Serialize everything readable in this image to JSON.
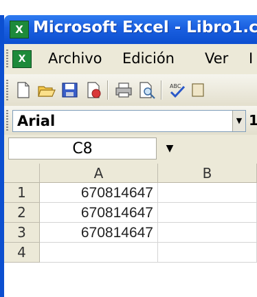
{
  "window": {
    "title": "Microsoft Excel - Libro1.c",
    "app_icon": "excel-icon"
  },
  "menubar": {
    "items": [
      "Archivo",
      "Edición",
      "Ver",
      "I"
    ]
  },
  "toolbar": {
    "buttons": [
      "new-icon",
      "open-icon",
      "save-icon",
      "permission-icon",
      "print-icon",
      "print-preview-icon",
      "spelling-icon"
    ]
  },
  "formatting": {
    "font": "Arial",
    "size": "1"
  },
  "formula_bar": {
    "cell_ref": "C8"
  },
  "sheet": {
    "columns": [
      "A",
      "B"
    ],
    "rows": [
      {
        "num": "1",
        "a": "670814647",
        "b": ""
      },
      {
        "num": "2",
        "a": "670814647",
        "b": ""
      },
      {
        "num": "3",
        "a": "670814647",
        "b": ""
      },
      {
        "num": "4",
        "a": "",
        "b": ""
      }
    ]
  },
  "colors": {
    "titlebar": "#0c4fd0",
    "chrome": "#ece9d8",
    "accent": "#1d8a3a"
  }
}
